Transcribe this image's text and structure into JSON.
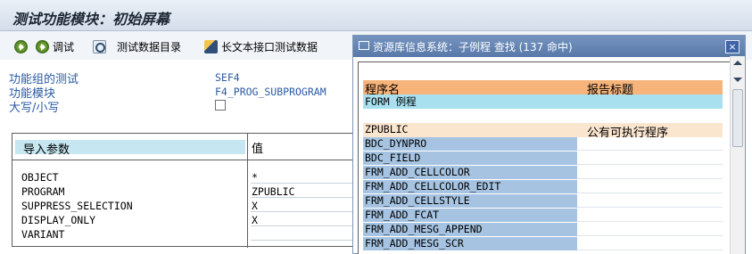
{
  "window": {
    "title": "测试功能模块：初始屏幕"
  },
  "toolbar": {
    "debug_label": "调试",
    "test_data_label": "测试数据目录",
    "long_text_label": "长文本接口测试数据"
  },
  "form": {
    "rows": [
      {
        "label": "功能组的测试",
        "value": "SEF4"
      },
      {
        "label": "功能模块",
        "value": "F4_PROG_SUBPROGRAM"
      },
      {
        "label": "大写/小写",
        "value": ""
      }
    ]
  },
  "params": {
    "header_name": "导入参数",
    "header_value": "值",
    "rows": [
      {
        "name": "OBJECT",
        "value": "*"
      },
      {
        "name": "PROGRAM",
        "value": "ZPUBLIC"
      },
      {
        "name": "SUPPRESS_SELECTION",
        "value": "X"
      },
      {
        "name": "DISPLAY_ONLY",
        "value": "X"
      },
      {
        "name": "VARIANT",
        "value": ""
      }
    ]
  },
  "popup": {
    "title": "资源库信息系统：子例程 查找 (137 命中)",
    "close_label": "×",
    "columns": {
      "name": "程序名",
      "report_title": "报告标题"
    },
    "form_row": "FORM 例程",
    "program": {
      "name": "ZPUBLIC",
      "title": "公有可执行程序"
    },
    "forms": [
      "BDC_DYNPRO",
      "BDC_FIELD",
      "FRM_ADD_CELLCOLOR",
      "FRM_ADD_CELLCOLOR_EDIT",
      "FRM_ADD_CELLSTYLE",
      "FRM_ADD_FCAT",
      "FRM_ADD_MESG_APPEND",
      "FRM_ADD_MESG_SCR"
    ]
  },
  "colors": {
    "header_orange": "#f7b47a",
    "form_cyan": "#a8e0f0",
    "list_blue": "#a6c4e2",
    "label_blue": "#2b5ba3",
    "popup_title": "#5878a8"
  }
}
